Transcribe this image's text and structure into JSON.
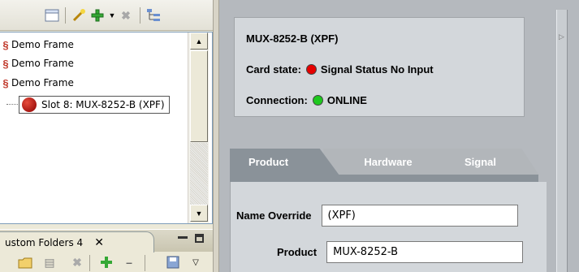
{
  "tree": {
    "items": [
      {
        "label": "Demo Frame"
      },
      {
        "label": "Demo Frame"
      },
      {
        "label": "Demo Frame"
      },
      {
        "label": "Slot 8: MUX-8252-B (XPF)"
      }
    ]
  },
  "bottom_tab": {
    "label": "ustom Folders 4",
    "close": "✕"
  },
  "card": {
    "title": "MUX-8252-B (XPF)",
    "state_label": "Card state:",
    "state_value": "Signal Status No Input",
    "state_color": "#e60000",
    "connection_label": "Connection:",
    "connection_value": "ONLINE",
    "connection_color": "#1ec81e"
  },
  "tabs": [
    {
      "label": "Product",
      "active": true
    },
    {
      "label": "Hardware",
      "active": false
    },
    {
      "label": "Signal",
      "active": false
    }
  ],
  "form": {
    "name_override_label": "Name Override",
    "name_override_value": "(XPF)",
    "product_label": "Product",
    "product_value": "MUX-8252-B"
  },
  "colors": {
    "tab_active": "#8a9299",
    "panel_bg": "#d3d7db",
    "workspace_bg": "#b5b9be"
  }
}
